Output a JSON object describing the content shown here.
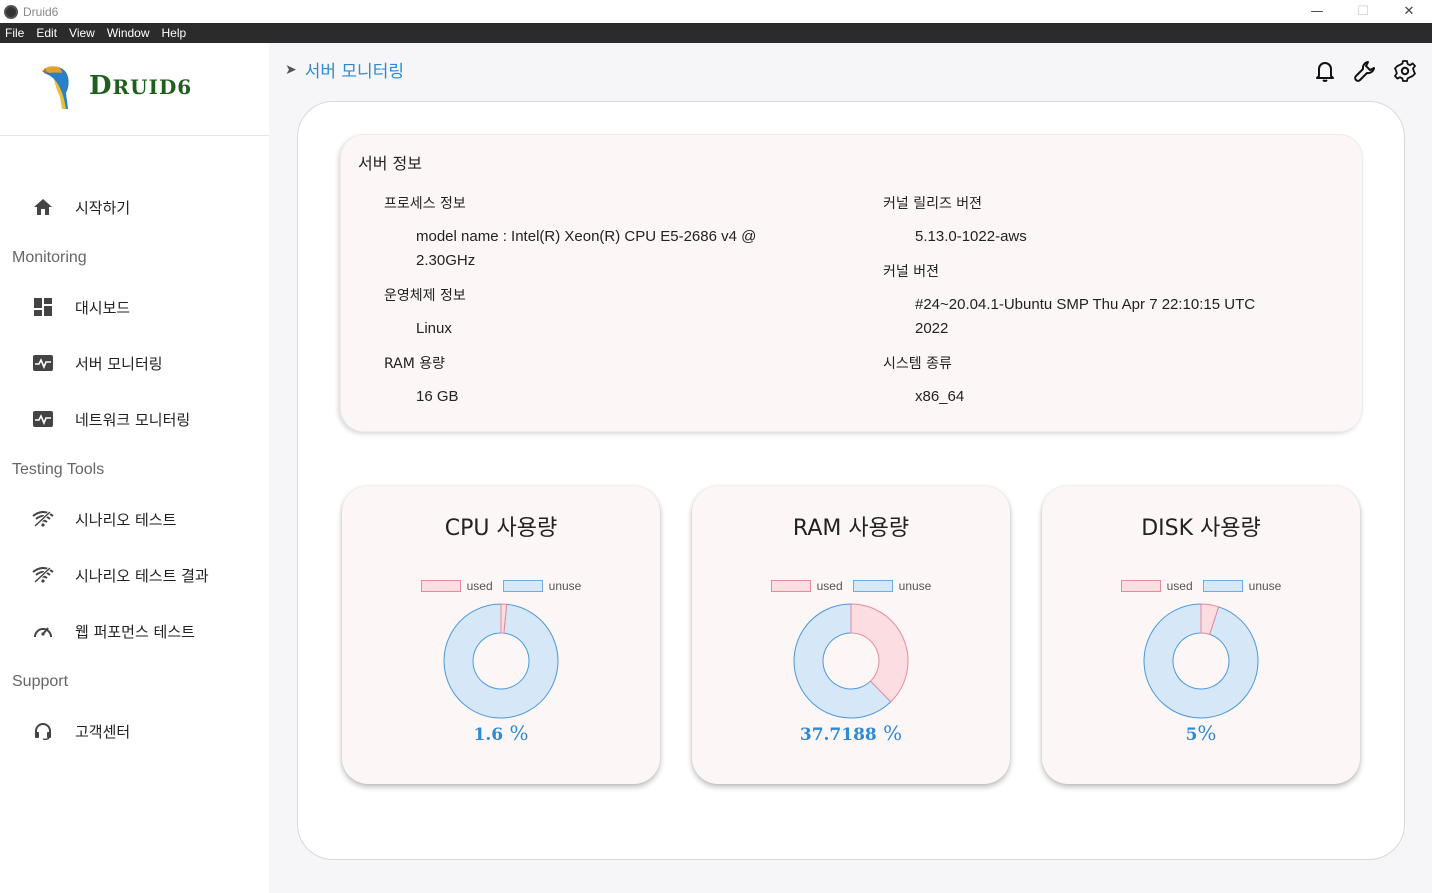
{
  "window": {
    "title": "Druid6",
    "minimize": "—",
    "maximize": "☐",
    "close": "✕"
  },
  "menu": [
    "File",
    "Edit",
    "View",
    "Window",
    "Help"
  ],
  "logo": {
    "text_big": "D",
    "text_rest": "RUID6"
  },
  "sidebar": {
    "home": "시작하기",
    "sections": {
      "monitoring": "Monitoring",
      "testing": "Testing Tools",
      "support": "Support"
    },
    "items": {
      "dashboard": "대시보드",
      "server_monitoring": "서버 모니터링",
      "network_monitoring": "네트워크 모니터링",
      "scenario_test": "시나리오 테스트",
      "scenario_result": "시나리오 테스트 결과",
      "web_perf": "웹 퍼포먼스 테스트",
      "customer_center": "고객센터"
    }
  },
  "breadcrumb": {
    "arrow": "➤",
    "current": "서버 모니터링"
  },
  "server_info": {
    "title": "서버 정보",
    "process_label": "프로세스 정보",
    "process_value_1": "model name : Intel(R) Xeon(R) CPU E5-2686 v4 @",
    "process_value_2": "2.30GHz",
    "os_label": "운영체제 정보",
    "os_value": "Linux",
    "ram_label": "RAM 용량",
    "ram_value": "16 GB",
    "kernel_release_label": "커널 릴리즈 버젼",
    "kernel_release_value": "5.13.0-1022-aws",
    "kernel_version_label": "커널 버젼",
    "kernel_version_value_1": "#24~20.04.1-Ubuntu SMP Thu Apr 7 22:10:15 UTC",
    "kernel_version_value_2": "2022",
    "system_type_label": "시스템 종류",
    "system_type_value": "x86_64"
  },
  "legend": {
    "used": "used",
    "unuse": "unuse"
  },
  "colors": {
    "accent": "#2c8ad8",
    "used_fill": "#fcdde2",
    "used_stroke": "#e88a9a",
    "unuse_fill": "#d6e8f8",
    "unuse_stroke": "#4a98dc"
  },
  "gauges": {
    "cpu": {
      "title": "CPU 사용량",
      "value": "1.6",
      "unit": " %",
      "percent": 1.6
    },
    "ram": {
      "title": "RAM 사용량",
      "value": "37.7188",
      "unit": " %",
      "percent": 37.7188
    },
    "disk": {
      "title": "DISK 사용량",
      "value": "5",
      "unit": "%",
      "percent": 5
    }
  }
}
